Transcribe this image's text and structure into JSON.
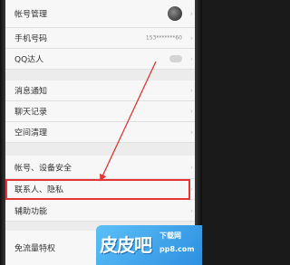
{
  "settings": {
    "items": [
      {
        "label": "帐号管理",
        "value": ""
      },
      {
        "label": "手机号码",
        "value": "153*******60"
      },
      {
        "label": "QQ达人",
        "value": ""
      },
      {
        "label": "消息通知",
        "value": ""
      },
      {
        "label": "聊天记录",
        "value": ""
      },
      {
        "label": "空间清理",
        "value": ""
      },
      {
        "label": "帐号、设备安全",
        "value": ""
      },
      {
        "label": "联系人、隐私",
        "value": ""
      },
      {
        "label": "辅助功能",
        "value": ""
      },
      {
        "label": "免流量特权",
        "value": ""
      }
    ],
    "chevron": "›"
  },
  "watermark": {
    "brand": "皮皮吧",
    "sub": "下载网",
    "url": "pp8.com"
  },
  "colors": {
    "highlight": "#e53535",
    "watermark": "#3aa5ee"
  }
}
